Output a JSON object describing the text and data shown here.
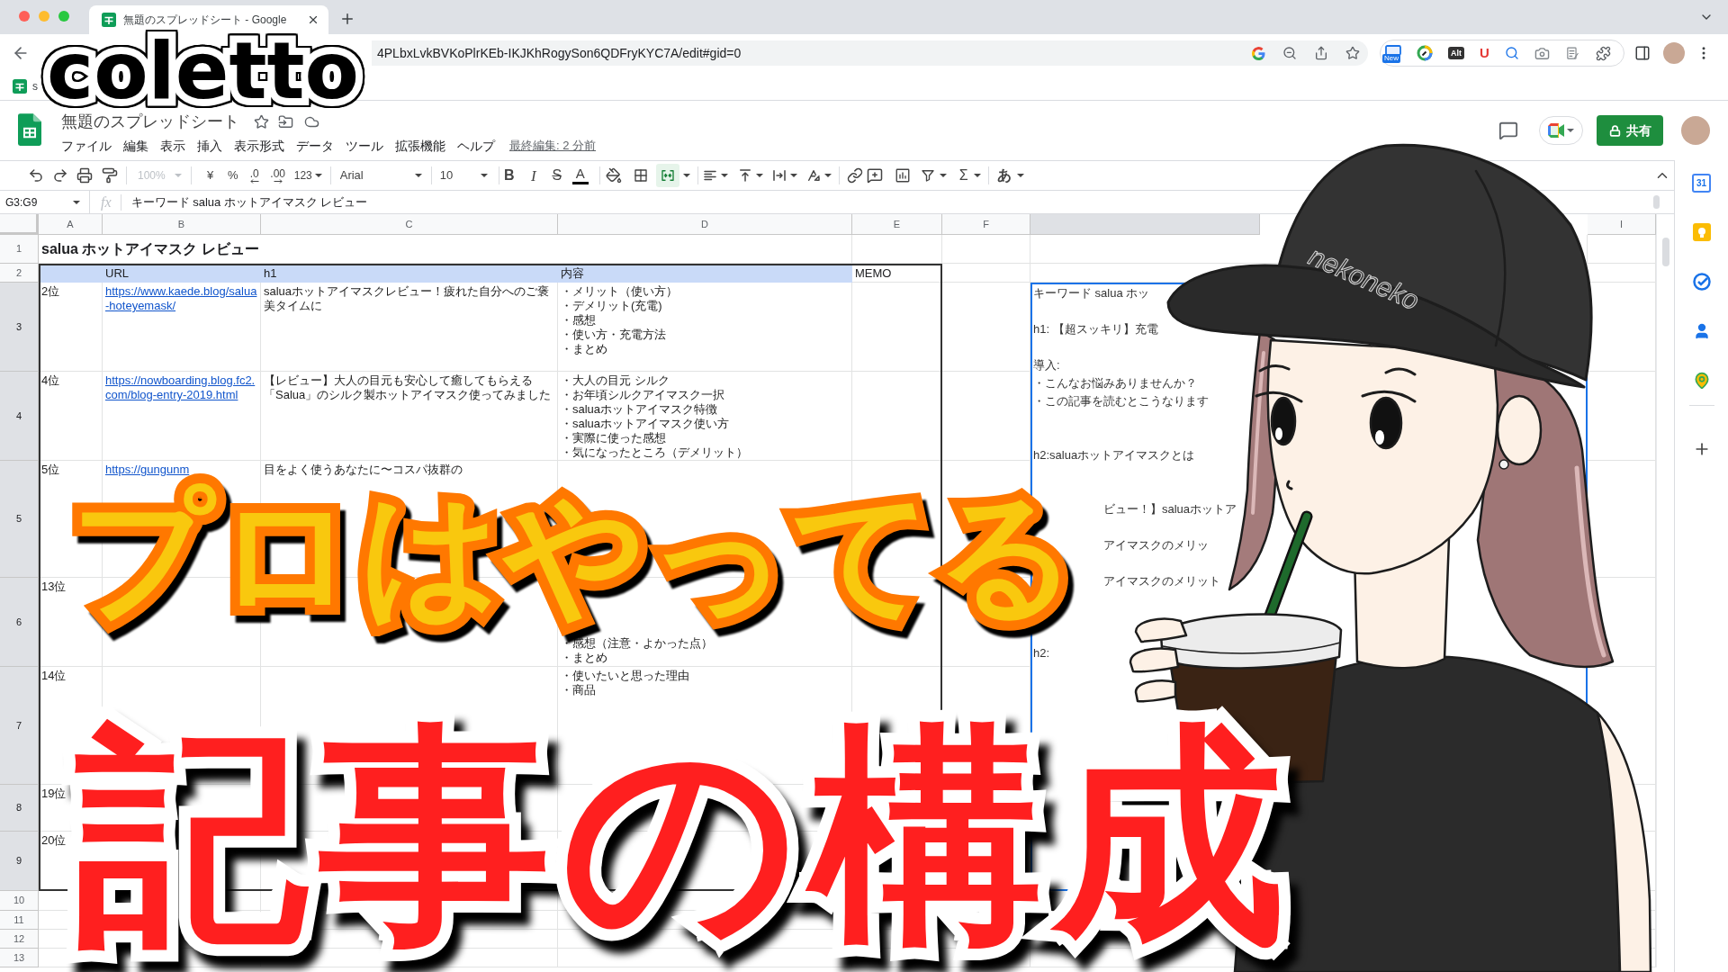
{
  "browser": {
    "tab_title": "無題のスプレッドシート - Google",
    "address": "4PLbxLvkBVKoPlrKEb-IKJKhRogySon6QDFryKYC7A/edit#gid=0",
    "extensions": {
      "badge": "New",
      "alt": "Alt",
      "letter": "U"
    },
    "bookmark": "s"
  },
  "logo": "coletto",
  "sheet": {
    "title": "無題のスプレッドシート",
    "menu": [
      "ファイル",
      "編集",
      "表示",
      "挿入",
      "表示形式",
      "データ",
      "ツール",
      "拡張機能",
      "ヘルプ"
    ],
    "last_edit": "最終編集: 2 分前",
    "share": "共有",
    "toolbar": {
      "zoom": "100%",
      "zoom_disabled": true,
      "currency": "¥",
      "percent": "%",
      "decimal_decrease": ".0",
      "decimal_increase": ".00",
      "more_formats": "123",
      "font": "Arial",
      "font_size": "10",
      "bold": "B",
      "italic": "I",
      "strikethrough": "S",
      "text_color": "A",
      "merge_active": true,
      "functions": "Σ",
      "input_tools": "あ"
    },
    "name_box": "G3:G9",
    "fx": "fx",
    "formula": "キーワード salua ホットアイマスク レビュー",
    "columns": [
      {
        "label": "A",
        "selected": false
      },
      {
        "label": "B",
        "selected": false
      },
      {
        "label": "C",
        "selected": false
      },
      {
        "label": "D",
        "selected": false
      },
      {
        "label": "E",
        "selected": false
      },
      {
        "label": "F",
        "selected": false
      },
      {
        "selected": true
      },
      {
        "label": "I",
        "selected": false
      }
    ],
    "rows": [
      {
        "number": "1",
        "selected": false,
        "kind": "title",
        "cells": {
          "A": "salua ホットアイマスク レビュー"
        }
      },
      {
        "number": "2",
        "selected": false,
        "kind": "header",
        "cells": {
          "B": "URL",
          "C": "h1",
          "D": "内容",
          "E": "MEMO"
        }
      },
      {
        "number": "3",
        "selected": true,
        "kind": "data",
        "cells": {
          "A": "2位",
          "B": "https://www.kaede.blog/salua-hoteyemask/",
          "C": "saluaホットアイマスクレビュー！疲れた自分へのご褒美タイムに",
          "D": [
            "・メリット（使い方）",
            "・デメリット(充電)",
            "・感想",
            "・使い方・充電方法",
            "・まとめ"
          ]
        }
      },
      {
        "number": "4",
        "selected": true,
        "kind": "data",
        "cells": {
          "A": "4位",
          "B": "https://nowboarding.blog.fc2.com/blog-entry-2019.html",
          "C": "【レビュー】大人の目元も安心して癒してもらえる「Salua」のシルク製ホットアイマスク使ってみました",
          "D": [
            "・大人の目元 シルク",
            "・お年頃シルクアイマスク一択",
            "・saluaホットアイマスク特徴",
            "・saluaホットアイマスク使い方",
            "・実際に使った感想",
            "・気になったところ（デメリット）"
          ]
        }
      },
      {
        "number": "5",
        "selected": true,
        "kind": "data",
        "cells": {
          "A": "5位",
          "B": "https://gungunm",
          "C": "目をよく使うあなたに〜コスパ抜群の"
        }
      },
      {
        "number": "6",
        "selected": true,
        "kind": "data",
        "cells": {
          "A": "13位",
          "D": [
            "・感想（注意・よかった点）",
            "・まとめ"
          ]
        }
      },
      {
        "number": "7",
        "selected": true,
        "kind": "data",
        "cells": {
          "A": "14位",
          "D": [
            "・使いたいと思った理由",
            "・商品"
          ]
        }
      },
      {
        "number": "8",
        "selected": true,
        "kind": "data",
        "cells": {
          "A": "19位"
        }
      },
      {
        "number": "9",
        "selected": true,
        "kind": "data",
        "cells": {
          "A": "20位"
        }
      },
      {
        "number": "10",
        "selected": false
      },
      {
        "number": "11",
        "selected": false
      },
      {
        "number": "12",
        "selected": false
      },
      {
        "number": "13",
        "selected": false
      }
    ],
    "merged_cell": {
      "lines": [
        {
          "kind": "line",
          "text": "キーワード salua ホッ"
        },
        {
          "kind": "blank"
        },
        {
          "kind": "line",
          "text": "h1: 【超スッキリ】充電"
        },
        {
          "kind": "blank"
        },
        {
          "kind": "line",
          "text": "導入:"
        },
        {
          "kind": "line",
          "text": "・こんなお悩みありませんか？"
        },
        {
          "kind": "line",
          "text": "・この記事を読むとこうなります"
        },
        {
          "kind": "blank"
        },
        {
          "kind": "blank"
        },
        {
          "kind": "line",
          "text": "h2:saluaホットアイマスクとは"
        },
        {
          "kind": "blank"
        },
        {
          "kind": "blank"
        },
        {
          "kind": "cut",
          "text": "ビュー！】saluaホットア"
        },
        {
          "kind": "blank"
        },
        {
          "kind": "cut",
          "text": "アイマスクのメリッ"
        },
        {
          "kind": "blank"
        },
        {
          "kind": "cut",
          "text": "アイマスクのメリット"
        },
        {
          "kind": "blank"
        },
        {
          "kind": "blank"
        },
        {
          "kind": "blank"
        },
        {
          "kind": "line",
          "text": "h2:"
        }
      ]
    }
  },
  "side_panel": {
    "calendar": "31"
  },
  "illustration": {
    "cap_text": "nekoneko"
  },
  "headline": {
    "top": "プロはやってる",
    "bottom": "記事の構成"
  }
}
